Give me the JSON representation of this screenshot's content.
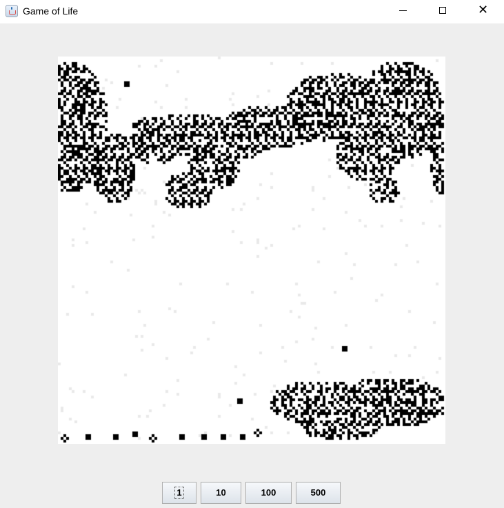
{
  "window": {
    "title": "Game of Life",
    "icon": "java-cup-icon",
    "controls": [
      "minimize-icon",
      "maximize-icon",
      "close-icon"
    ],
    "close_glyph": "✕"
  },
  "board": {
    "alive_color": "#000000",
    "dead_color": "#ffffff",
    "faint_color": "#e9e9e9"
  },
  "buttons": [
    {
      "label": "1"
    },
    {
      "label": "10"
    },
    {
      "label": "100"
    },
    {
      "label": "500"
    }
  ]
}
